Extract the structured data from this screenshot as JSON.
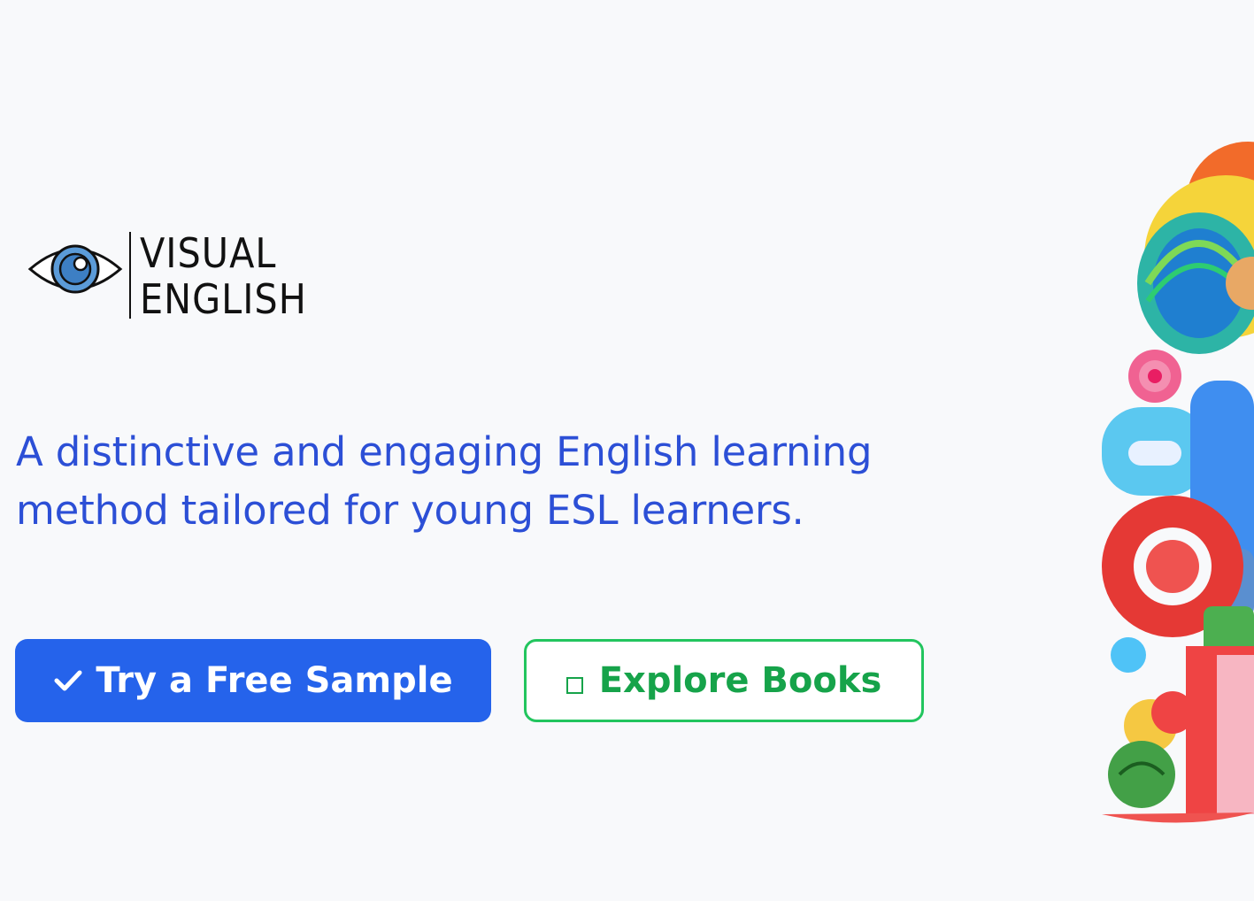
{
  "brand": {
    "line1": "VISUAL",
    "line2": "ENGLISH"
  },
  "tagline": "A distinctive and engaging English learning method tailored for young ESL learners.",
  "actions": {
    "primary": {
      "label": "Try a Free Sample",
      "icon": "checkmark-icon"
    },
    "secondary": {
      "label": "Explore Books",
      "icon": "square-icon"
    }
  },
  "colors": {
    "accent": "#2563eb",
    "tagline": "#2c4fd6",
    "secondary": "#16a34a",
    "secondary_border": "#22c55e",
    "background": "#f8f9fb"
  }
}
